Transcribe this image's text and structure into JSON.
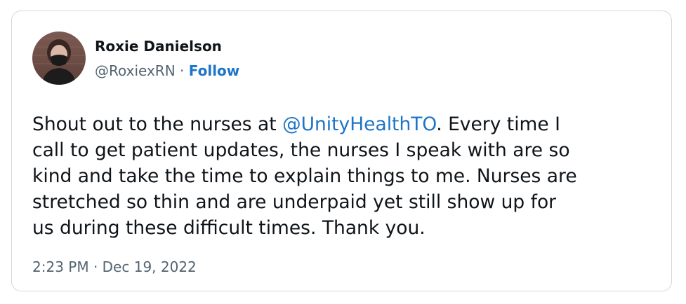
{
  "tweet": {
    "author": {
      "display_name": "Roxie Danielson",
      "handle": "@RoxiexRN",
      "separator": " · ",
      "follow_label": "Follow",
      "avatar_icon": "profile-photo"
    },
    "text": {
      "lines": [
        "Shout out to the nurses at ",
        "@UnityHealthTO",
        ". Every time I",
        "call to get patient updates, the nurses I speak with are so",
        "kind and take the time to explain things to me. Nurses are",
        "stretched so thin and are underpaid yet still show up for",
        "us during these difficult times. Thank you."
      ]
    },
    "timestamp": "2:23 PM · Dec 19, 2022"
  },
  "colors": {
    "link": "#1d74c8",
    "text": "#0f1419",
    "secondary": "#536471",
    "border": "#cfd9de"
  }
}
